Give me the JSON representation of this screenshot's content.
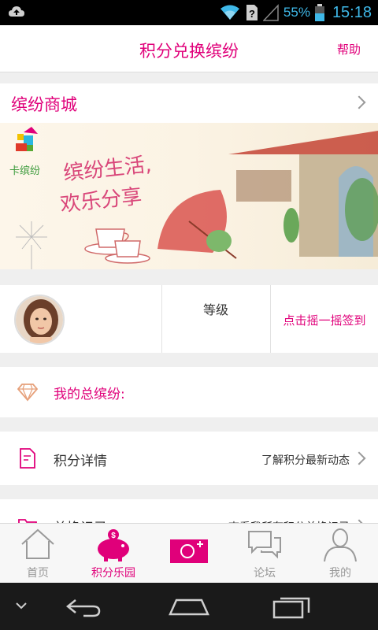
{
  "status_bar": {
    "battery_percent": "55%",
    "time": "15:18",
    "icons": [
      "cloud-upload-icon",
      "wifi-icon",
      "sim-unknown-icon",
      "signal-icon",
      "battery-icon"
    ]
  },
  "header": {
    "title": "积分兑换缤纷",
    "help_label": "帮助"
  },
  "mall": {
    "label": "缤纷商城"
  },
  "banner": {
    "logo_text": "卡缤纷",
    "slogan_line1": "缤纷生活,",
    "slogan_line2": "欢乐分享"
  },
  "profile": {
    "grade_label": "等级",
    "shake_label": "点击摇一摇签到"
  },
  "total": {
    "label": "我的总缤纷:"
  },
  "points_detail": {
    "label": "积分详情",
    "sub_label": "了解积分最新动态"
  },
  "exchange_record": {
    "label": "兑换记录",
    "sub_label": "查看我所有积分兑换记录"
  },
  "tabs": [
    {
      "label": "首页",
      "icon": "home-icon",
      "active": false
    },
    {
      "label": "积分乐园",
      "icon": "piggy-bank-icon",
      "active": true
    },
    {
      "label": "",
      "icon": "camera-icon",
      "active": false
    },
    {
      "label": "论坛",
      "icon": "chat-bubbles-icon",
      "active": false
    },
    {
      "label": "我的",
      "icon": "user-icon",
      "active": false
    }
  ],
  "colors": {
    "accent": "#e0007a",
    "inactive": "#999999",
    "status_blue": "#3fb8e8"
  }
}
